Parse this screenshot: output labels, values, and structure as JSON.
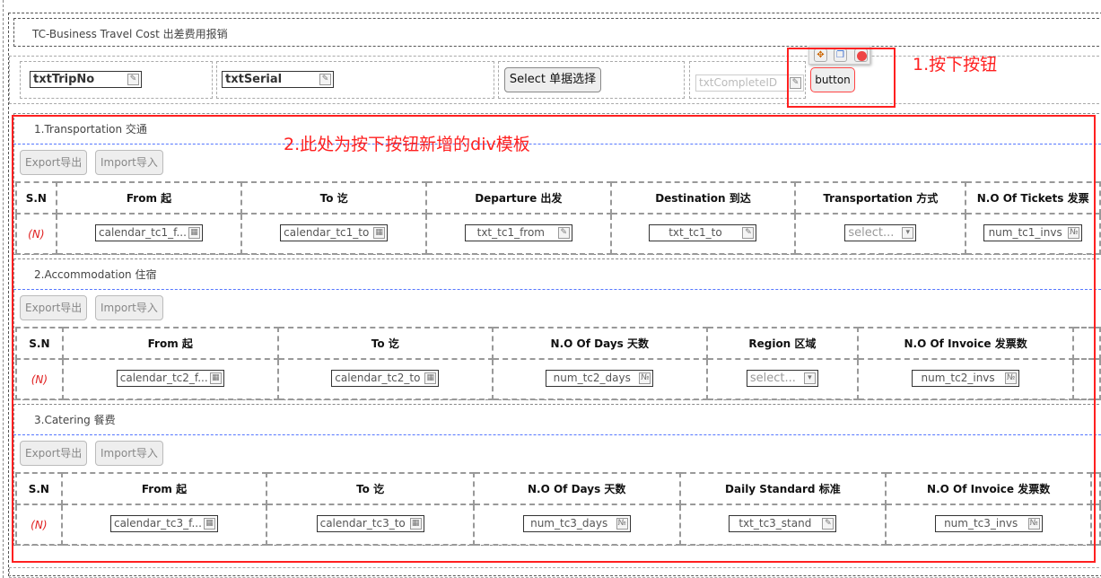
{
  "form_title": "TC-Business Travel Cost 出差费用报销",
  "header_fields": {
    "trip_no": "txtTripNo",
    "serial": "txtSerial",
    "select_button": "Select 单据选择",
    "complete_id": "txtCompleteID",
    "button": "button"
  },
  "annotations": {
    "step1": "1.按下按钮",
    "step2": "2.此处为按下按钮新增的div模板"
  },
  "toolbar_icons": [
    "move-icon",
    "copy-icon",
    "delete-icon"
  ],
  "export_label": "Export导出",
  "import_label": "Import导入",
  "sections": [
    {
      "title": "1.Transportation 交通",
      "headers": [
        "S.N",
        "From 起",
        "To 讫",
        "Departure 出发",
        "Destination 到达",
        "Transportation 方式",
        "N.O Of Tickets 发票"
      ],
      "row": [
        "(N)",
        "calendar_tc1_f...",
        "calendar_tc1_to",
        "txt_tc1_from",
        "txt_tc1_to",
        "select...",
        "num_tc1_invs"
      ]
    },
    {
      "title": "2.Accommodation 住宿",
      "headers": [
        "S.N",
        "From 起",
        "To 讫",
        "N.O Of Days 天数",
        "Region 区域",
        "N.O Of Invoice 发票数",
        ""
      ],
      "row": [
        "(N)",
        "calendar_tc2_f...",
        "calendar_tc2_to",
        "num_tc2_days",
        "select...",
        "num_tc2_invs",
        ""
      ]
    },
    {
      "title": "3.Catering 餐费",
      "headers": [
        "S.N",
        "From 起",
        "To 讫",
        "N.O Of Days 天数",
        "Daily Standard 标准",
        "N.O Of Invoice 发票数",
        ""
      ],
      "row": [
        "(N)",
        "calendar_tc3_f...",
        "calendar_tc3_to",
        "num_tc3_days",
        "txt_tc3_stand",
        "num_tc3_invs",
        ""
      ]
    }
  ]
}
